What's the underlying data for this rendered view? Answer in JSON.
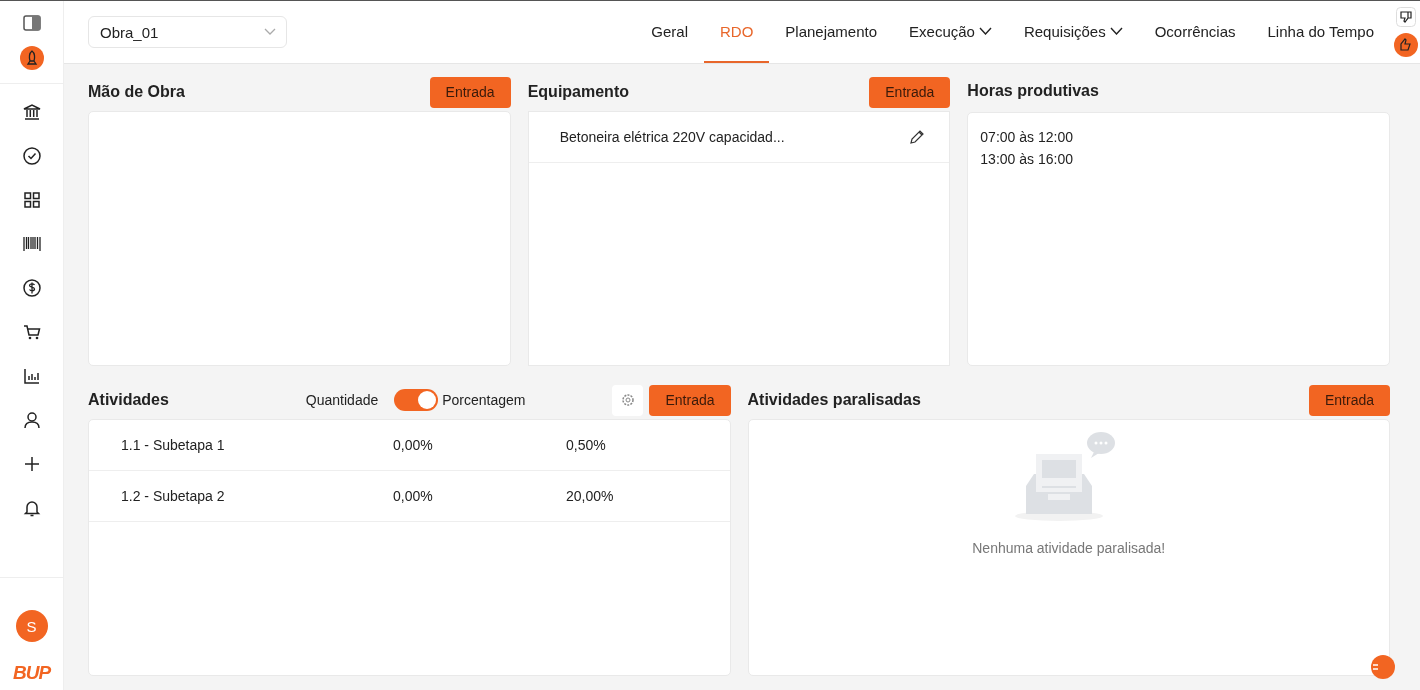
{
  "project_select": {
    "value": "Obra_01"
  },
  "sidebar": {
    "items": [
      {
        "kind": "bank"
      },
      {
        "kind": "check"
      },
      {
        "kind": "grid"
      },
      {
        "kind": "barcode"
      },
      {
        "kind": "dollar"
      },
      {
        "kind": "cart"
      },
      {
        "kind": "chart"
      },
      {
        "kind": "user"
      },
      {
        "kind": "plus"
      },
      {
        "kind": "bell"
      }
    ],
    "avatar": "S",
    "logo": "BUP"
  },
  "tabs": [
    {
      "label": "Geral",
      "selected": false,
      "has_menu": false
    },
    {
      "label": "RDO",
      "selected": true,
      "has_menu": false
    },
    {
      "label": "Planejamento",
      "selected": false,
      "has_menu": false
    },
    {
      "label": "Execução",
      "selected": false,
      "has_menu": true
    },
    {
      "label": "Requisições",
      "selected": false,
      "has_menu": true
    },
    {
      "label": "Ocorrências",
      "selected": false,
      "has_menu": false
    },
    {
      "label": "Linha do Tempo",
      "selected": false,
      "has_menu": false
    }
  ],
  "mao_de_obra": {
    "title": "Mão de Obra",
    "button": "Entrada"
  },
  "equipamento": {
    "title": "Equipamento",
    "button": "Entrada",
    "items": [
      "Betoneira elétrica 220V capacidad..."
    ]
  },
  "horas_produtivas": {
    "title": "Horas produtivas",
    "items": [
      "07:00 às 12:00",
      "13:00 às 16:00"
    ]
  },
  "atividades": {
    "title": "Atividades",
    "toggle": {
      "left_label": "Quantidade",
      "right_label": "Porcentagem",
      "on": true
    },
    "button": "Entrada",
    "rows": [
      {
        "name": "1.1 - Subetapa 1",
        "column_2": "0,00%",
        "column_3": "0,50%"
      },
      {
        "name": "1.2 - Subetapa 2",
        "column_2": "0,00%",
        "column_3": "20,00%"
      }
    ]
  },
  "atividades_paralisadas": {
    "title": "Atividades paralisadas",
    "button": "Entrada",
    "empty_message": "Nenhuma atividade paralisada!"
  }
}
